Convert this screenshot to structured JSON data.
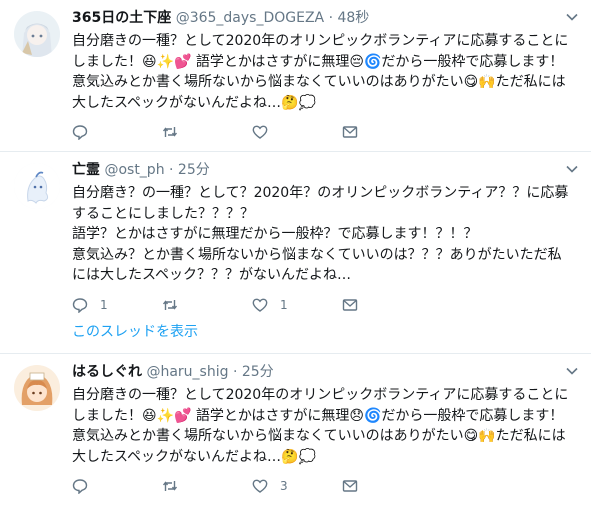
{
  "tweets": [
    {
      "name": "365日の土下座",
      "handle": "@365_days_DOGEZA",
      "sep": "·",
      "time": "48秒",
      "text": "自分磨きの一種？として2020年のオリンピックボランティアに応募することにしました！😆✨💕 語学とかはさすがに無理😔🌀だから一般枠で応募します！ 意気込みとか書く場所ないから悩まなくていいのはありがたい😋🙌ただ私には大したスペックがないんだよね…🤔💭",
      "avatar_icon": "anime-character-icon",
      "reply_count": "",
      "retweet_count": "",
      "like_count": ""
    },
    {
      "name": "亡霊",
      "handle": "@ost_ph",
      "sep": "·",
      "time": "25分",
      "text": "自分磨き？の一種？として？2020年？のオリンピックボランティア？？に応募することにしました？？？？\n語学？とかはさすがに無理だから一般枠？で応募します！？！？\n意気込み？とか書く場所ないから悩まなくていいのは？？？ありがたいただ私には大したスペック？？？がないんだよね…",
      "avatar_icon": "ghost-character-icon",
      "reply_count": "1",
      "retweet_count": "",
      "like_count": "1",
      "thread_link": "このスレッドを表示"
    },
    {
      "name": "はるしぐれ",
      "handle": "@haru_shig",
      "sep": "·",
      "time": "25分",
      "text": "自分磨きの一種？として2020年のオリンピックボランティアに応募することにしました！😆✨💕 語学とかはさすがに無理😞🌀だから一般枠で応募します！ 意気込みとか書く場所ないから悩まなくていいのはありがたい😋🙌ただ私には大したスペックがないんだよね…🤔💭",
      "avatar_icon": "girl-character-icon",
      "reply_count": "",
      "retweet_count": "",
      "like_count": "3"
    }
  ],
  "colors": {
    "text": "#14171a",
    "secondary": "#657786",
    "link": "#1da1f2",
    "divider": "#e6ecf0"
  }
}
